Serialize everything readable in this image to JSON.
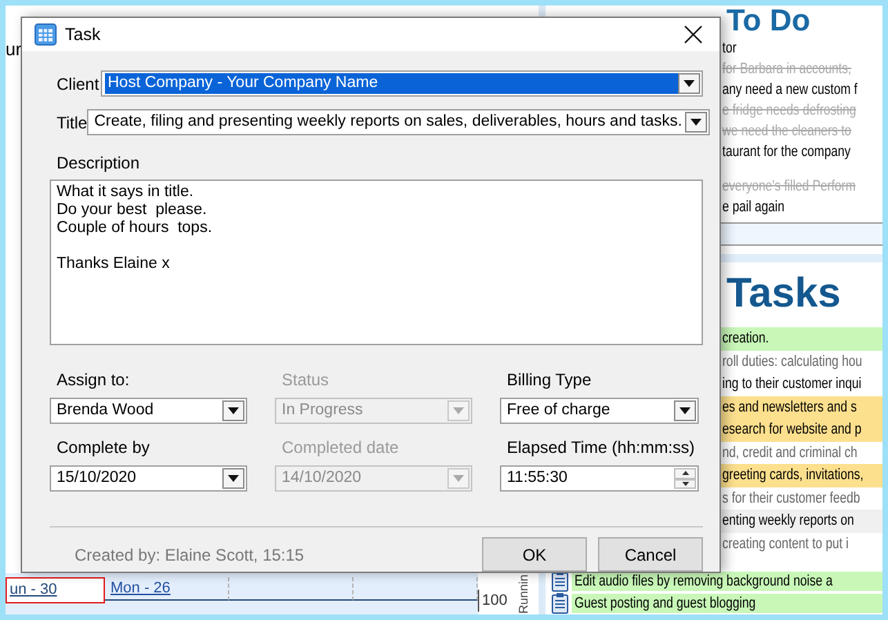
{
  "background": {
    "heading_fragment": "ur",
    "todo": {
      "title": "To Do",
      "items": [
        {
          "text": "tor",
          "done": false
        },
        {
          "text": "for Barbara in accounts,",
          "done": true
        },
        {
          "text": "any need a new custom f",
          "done": false
        },
        {
          "text": "e fridge needs defrosting",
          "done": true
        },
        {
          "text": "we need the cleaners to",
          "done": true
        },
        {
          "text": "taurant for the company",
          "done": false
        },
        {
          "text": "everyone's filled Perform",
          "done": true
        },
        {
          "text": "e pail again",
          "done": false
        }
      ]
    },
    "tasks": {
      "title": "Tasks",
      "items": [
        {
          "text": "creation.",
          "color": "#c8f7b8",
          "muted": false
        },
        {
          "text": "roll duties: calculating hou",
          "color": "#ffffff",
          "muted": true
        },
        {
          "text": "ing to their customer inqui",
          "color": "#ffffff",
          "muted": false
        },
        {
          "text": "es and newsletters and s",
          "color": "#fde08e",
          "muted": false
        },
        {
          "text": "esearch for website and p",
          "color": "#fde08e",
          "muted": false
        },
        {
          "text": "nd, credit and criminal ch",
          "color": "#ffffff",
          "muted": true
        },
        {
          "text": "greeting cards, invitations,",
          "color": "#fde08e",
          "muted": false
        },
        {
          "text": "s for their customer feedb",
          "color": "#ffffff",
          "muted": true
        },
        {
          "text": "enting weekly reports on",
          "color": "#f0f0f0",
          "muted": false
        },
        {
          "text": "creating content to put i",
          "color": "#ffffff",
          "muted": true
        }
      ],
      "full_items": [
        {
          "text": "Edit audio files by removing background noise a",
          "color": "#c8f7b8"
        },
        {
          "text": "Guest posting and guest blogging",
          "color": "#c8f7b8"
        }
      ]
    },
    "calendar": {
      "days": [
        {
          "label": "un  - 30",
          "selected": true
        },
        {
          "label": "Mon  - 26",
          "selected": false
        }
      ],
      "axis_tick": "100",
      "axis_label": "Runnin"
    }
  },
  "dialog": {
    "title": "Task",
    "client": {
      "label": "Client",
      "value": "Host Company - Your Company Name",
      "highlighted": true
    },
    "task_title": {
      "label": "Title",
      "value": "Create, filing and presenting weekly reports on sales, deliverables, hours and tasks.",
      "highlighted": false
    },
    "description": {
      "label": "Description",
      "value": "What it says in title.\nDo your best  please.\nCouple of hours  tops.\n\nThanks Elaine x"
    },
    "fields": [
      {
        "label": "Assign to:",
        "value": "Brenda Wood",
        "kind": "dropdown",
        "disabled": false
      },
      {
        "label": "Status",
        "value": "In Progress",
        "kind": "dropdown",
        "disabled": true
      },
      {
        "label": "Billing Type",
        "value": "Free of charge",
        "kind": "dropdown",
        "disabled": false
      },
      {
        "label": "Complete by",
        "value": "15/10/2020",
        "kind": "dropdown",
        "disabled": false
      },
      {
        "label": "Completed date",
        "value": "14/10/2020",
        "kind": "dropdown",
        "disabled": true
      },
      {
        "label": "Elapsed Time (hh:mm:ss)",
        "value": "11:55:30",
        "kind": "spinner",
        "disabled": false
      }
    ],
    "created_by": "Created by: Elaine Scott,  15:15",
    "buttons": [
      "OK",
      "Cancel"
    ]
  }
}
